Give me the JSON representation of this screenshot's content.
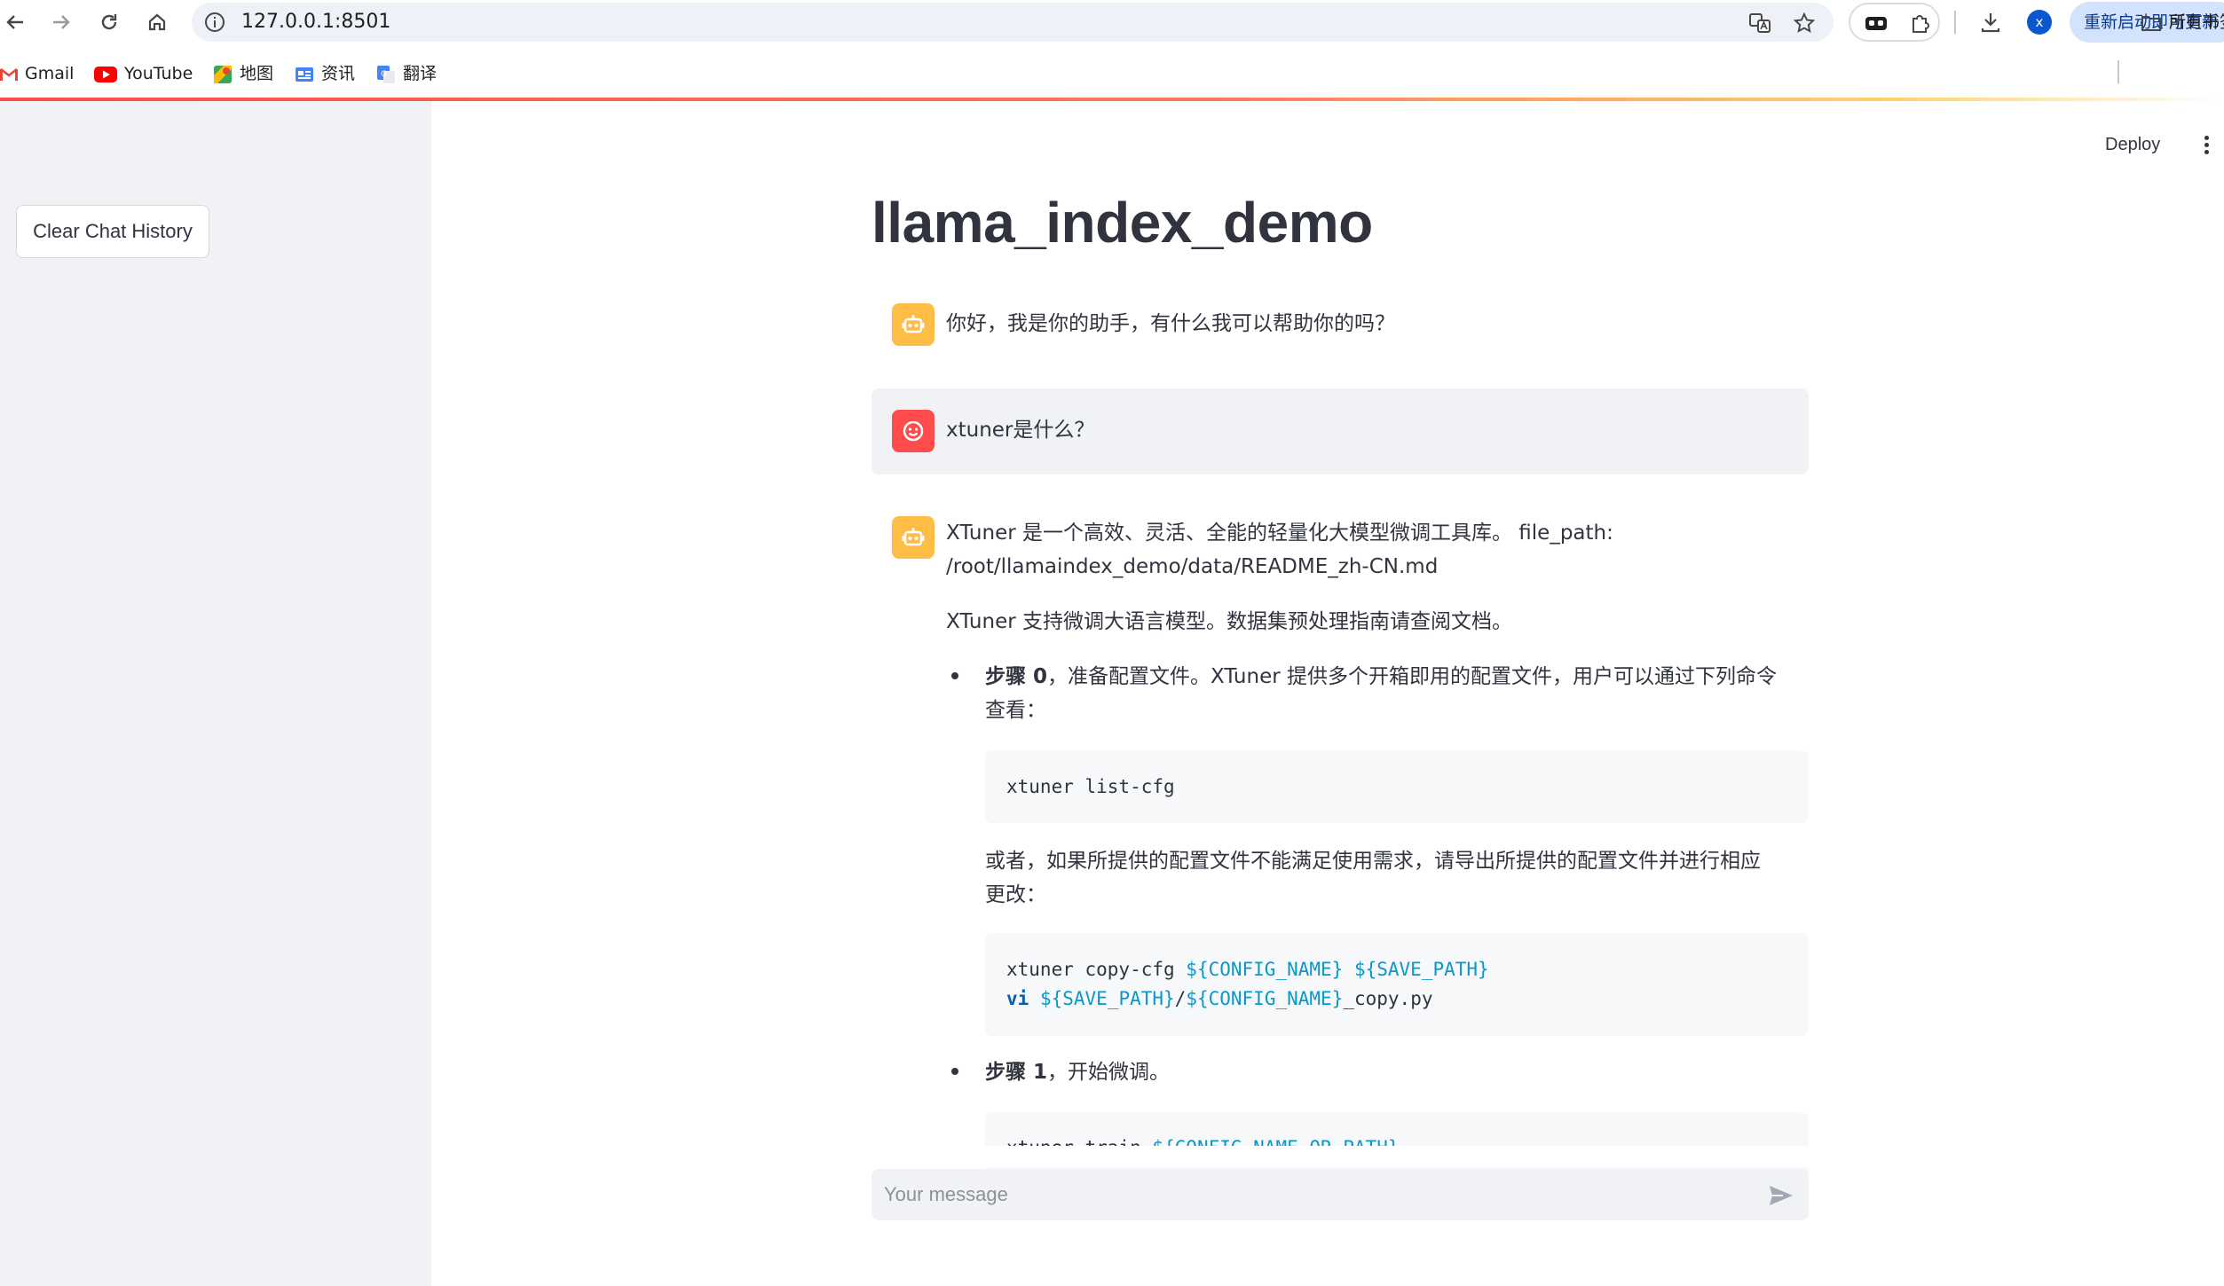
{
  "browser": {
    "url": "127.0.0.1:8501",
    "update_button": "重新启动即可更新",
    "profile_initial": "x",
    "bookmarks": [
      "Gmail",
      "YouTube",
      "地图",
      "资讯",
      "翻译"
    ],
    "all_bookmarks": "所有书签"
  },
  "sidebar": {
    "clear_button": "Clear Chat History"
  },
  "header": {
    "deploy": "Deploy"
  },
  "page": {
    "title": "llama_index_demo"
  },
  "chat": {
    "greeting": "你好，我是你的助手，有什么我可以帮助你的吗？",
    "user_question": "xtuner是什么？",
    "answer": {
      "p1_line1": "XTuner 是一个高效、灵活、全能的轻量化大模型微调工具库。 file_path:",
      "p1_line2": "/root/llamaindex_demo/data/README_zh-CN.md",
      "p2": "XTuner 支持微调大语言模型。数据集预处理指南请查阅文档。",
      "step0_bold": "步骤 0",
      "step0_line1": "，准备配置文件。XTuner 提供多个开箱即用的配置文件，用户可以通过下列命令",
      "step0_line2": "查看：",
      "code1": "xtuner list-cfg",
      "or_line1": "或者，如果所提供的配置文件不能满足使用需求，请导出所提供的配置文件并进行相应",
      "or_line2": "更改：",
      "code2_cmd": "xtuner copy-cfg ",
      "code2_var1": "${CONFIG_NAME}",
      "code2_var2": "${SAVE_PATH}",
      "code2_kw": "vi",
      "code2_slash": "/",
      "code2_suffix": "_copy.py",
      "step1_bold": "步骤 1",
      "step1_rest": "，开始微调。",
      "code3_cmd": "xtuner train ",
      "code3_var": "${CONFIG_NAME_OR_PATH}"
    }
  },
  "input": {
    "placeholder": "Your message"
  }
}
